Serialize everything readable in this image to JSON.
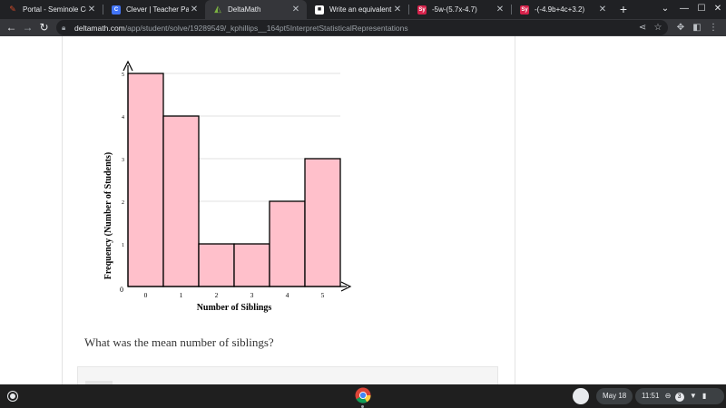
{
  "browser": {
    "tabs": [
      {
        "title": "Portal - Seminole Coun",
        "icon": "feather-icon",
        "icon_color": "#d04a28",
        "close": "✕",
        "active": false
      },
      {
        "title": "Clever | Teacher Page",
        "icon": "clever-icon",
        "icon_color": "#4274f6",
        "icon_text": "C",
        "close": "✕",
        "active": false
      },
      {
        "title": "DeltaMath",
        "icon": "deltamath-icon",
        "icon_color": "#2e7d32",
        "close": "✕",
        "active": true
      },
      {
        "title": "Write an equivalent exp",
        "icon": "brainly-icon",
        "icon_color": "#ffffff",
        "close": "✕",
        "active": false
      },
      {
        "title": "-5w-(5.7x-4.7)",
        "icon": "symbolab-icon",
        "icon_color": "#d6224b",
        "icon_text": "Sy",
        "close": "✕",
        "active": false
      },
      {
        "title": "-(-4.9b+4c+3.2)",
        "icon": "symbolab-icon",
        "icon_color": "#d6224b",
        "icon_text": "Sy",
        "close": "✕",
        "active": false
      }
    ],
    "new_tab": "+",
    "url_host": "deltamath.com",
    "url_path": "/app/student/solve/19289549/_kphillips__164pt5InterpretStatisticalRepresentations"
  },
  "chart_data": {
    "type": "bar",
    "categories": [
      "0",
      "1",
      "2",
      "3",
      "4",
      "5"
    ],
    "values": [
      5,
      4,
      1,
      1,
      2,
      3
    ],
    "y_ticks": [
      "0",
      "1",
      "2",
      "3",
      "4",
      "5"
    ],
    "xlabel": "Number of Siblings",
    "ylabel": "Frequency (Number of Students)",
    "ylim": [
      0,
      5
    ],
    "grid": true,
    "bar_color": "#ffc0cb",
    "bar_stroke": "#000000"
  },
  "question": "What was the mean number of siblings?",
  "shelf": {
    "date": "May 18",
    "time": "11:51",
    "notification_count": "3"
  }
}
